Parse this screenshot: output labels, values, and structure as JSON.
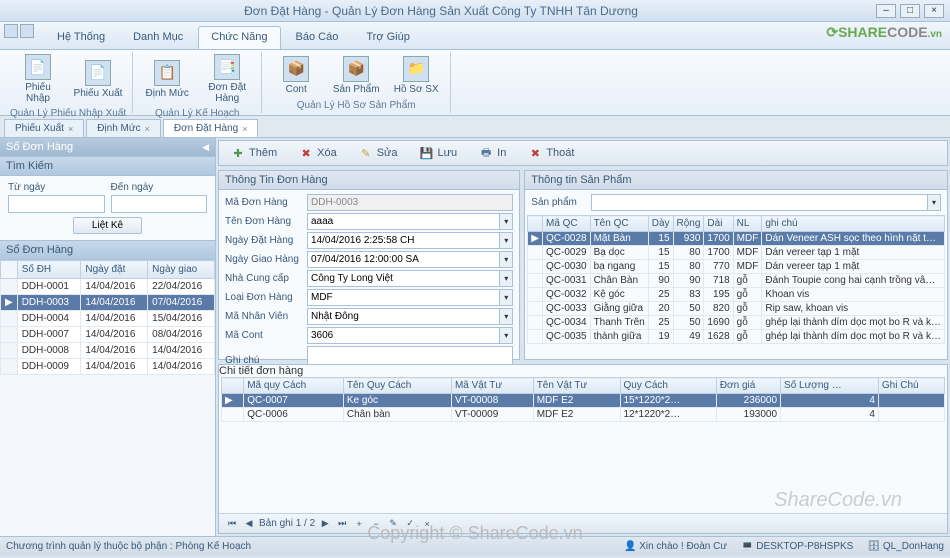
{
  "window": {
    "title": "Đơn Đặt Hàng - Quản Lý Đơn Hàng Sản Xuất Công Ty TNHH Tân Dương"
  },
  "logo": {
    "brand1": "SHARE",
    "brand2": "CODE",
    "suffix": ".vn"
  },
  "menu": {
    "tabs": [
      "Hệ Thống",
      "Danh Mục",
      "Chức Năng",
      "Báo Cáo",
      "Trợ Giúp"
    ],
    "active": 2
  },
  "ribbon": {
    "groups": [
      {
        "caption": "Quản Lý Phiếu Nhập Xuất",
        "buttons": [
          {
            "label": "Phiếu Nhập",
            "icon": "📄"
          },
          {
            "label": "Phiếu Xuất",
            "icon": "📄"
          }
        ]
      },
      {
        "caption": "Quản Lý Kế Hoạch",
        "buttons": [
          {
            "label": "Định Mức",
            "icon": "📋"
          },
          {
            "label": "Đơn Đặt Hàng",
            "icon": "📑"
          }
        ]
      },
      {
        "caption": "Quản Lý Hồ Sơ Sản Phẩm",
        "buttons": [
          {
            "label": "Cont",
            "icon": "📦"
          },
          {
            "label": "Sản Phẩm",
            "icon": "📦"
          },
          {
            "label": "Hồ Sơ SX",
            "icon": "📁"
          }
        ]
      }
    ]
  },
  "doctabs": [
    {
      "label": "Phiếu Xuất"
    },
    {
      "label": "Định Mức"
    },
    {
      "label": "Đơn Đặt Hàng",
      "active": true
    }
  ],
  "left": {
    "panel_title": "Sổ Đơn Hàng",
    "filter": {
      "title": "Tìm Kiếm",
      "from_label": "Từ ngày",
      "to_label": "Đến ngày",
      "list_btn": "Liệt Kê"
    },
    "orders": {
      "title": "Sổ Đơn Hàng",
      "cols": [
        "Số ĐH",
        "Ngày đặt",
        "Ngày giao"
      ],
      "rows": [
        {
          "id": "DDH-0001",
          "d1": "14/04/2016",
          "d2": "22/04/2016"
        },
        {
          "id": "DDH-0003",
          "d1": "14/04/2016",
          "d2": "07/04/2016",
          "sel": true
        },
        {
          "id": "DDH-0004",
          "d1": "14/04/2016",
          "d2": "15/04/2016"
        },
        {
          "id": "DDH-0007",
          "d1": "14/04/2016",
          "d2": "08/04/2016"
        },
        {
          "id": "DDH-0008",
          "d1": "14/04/2016",
          "d2": "14/04/2016"
        },
        {
          "id": "DDH-0009",
          "d1": "14/04/2016",
          "d2": "14/04/2016"
        }
      ]
    }
  },
  "toolbar": [
    {
      "label": "Thêm",
      "icon": "add",
      "glyph": "✚"
    },
    {
      "label": "Xóa",
      "icon": "del",
      "glyph": "✖"
    },
    {
      "label": "Sửa",
      "icon": "edit",
      "glyph": "✎"
    },
    {
      "label": "Lưu",
      "icon": "save",
      "glyph": "💾"
    },
    {
      "label": "In",
      "icon": "print",
      "glyph": "🖶"
    },
    {
      "label": "Thoát",
      "icon": "exit",
      "glyph": "✖"
    }
  ],
  "orderinfo": {
    "title": "Thông Tin Đơn Hàng",
    "fields": {
      "ma_label": "Mã Đơn Hàng",
      "ma_val": "DDH-0003",
      "ten_label": "Tên Đơn Hàng",
      "ten_val": "aaaa",
      "ngaydat_label": "Ngày Đặt Hàng",
      "ngaydat_val": "14/04/2016 2:25:58 CH",
      "ngaygiao_label": "Ngày Giao Hàng",
      "ngaygiao_val": "07/04/2016 12:00:00 SA",
      "ncc_label": "Nhà Cung cấp",
      "ncc_val": "Công Ty Long Việt",
      "loai_label": "Loại Đơn Hàng",
      "loai_val": "MDF",
      "nv_label": "Mã Nhân Viên",
      "nv_val": "Nhật Đông",
      "cont_label": "Mã Cont",
      "cont_val": "3606",
      "ghichu_label": "Ghi chú",
      "ghichu_val": ""
    }
  },
  "prodinfo": {
    "title": "Thông tin Sản Phẩm",
    "sp_label": "Sản phẩm",
    "cols": [
      "Mã QC",
      "Tên QC",
      "Dày",
      "Rộng",
      "Dài",
      "NL",
      "ghi chú"
    ],
    "rows": [
      {
        "ma": "QC-0028",
        "ten": "Mặt Bàn",
        "day": "15",
        "rong": "930",
        "dai": "1700",
        "nl": "MDF",
        "gc": "Dán Veneer ASH sọc theo hình nặt t…",
        "sel": true
      },
      {
        "ma": "QC-0029",
        "ten": "Bạ dọc",
        "day": "15",
        "rong": "80",
        "dai": "1700",
        "nl": "MDF",
        "gc": "Dán vereer tạp 1 mặt"
      },
      {
        "ma": "QC-0030",
        "ten": "bạ ngang",
        "day": "15",
        "rong": "80",
        "dai": "770",
        "nl": "MDF",
        "gc": "Dán vereer tạp 1 mặt"
      },
      {
        "ma": "QC-0031",
        "ten": "Chân Bàn",
        "day": "90",
        "rong": "90",
        "dai": "718",
        "nl": "gỗ",
        "gc": "Đánh Toupie cong hai cạnh trồng vâ…"
      },
      {
        "ma": "QC-0032",
        "ten": "Kệ góc",
        "day": "25",
        "rong": "83",
        "dai": "195",
        "nl": "gỗ",
        "gc": "Khoan vis"
      },
      {
        "ma": "QC-0033",
        "ten": "Giằng giữa",
        "day": "20",
        "rong": "50",
        "dai": "820",
        "nl": "gỗ",
        "gc": "Rip saw, khoan vis"
      },
      {
        "ma": "QC-0034",
        "ten": "Thanh Trên",
        "day": "25",
        "rong": "50",
        "dai": "1690",
        "nl": "gỗ",
        "gc": "ghép lại thành dím dọc mọt bo R và k…"
      },
      {
        "ma": "QC-0035",
        "ten": "thành giữa",
        "day": "19",
        "rong": "49",
        "dai": "1628",
        "nl": "gỗ",
        "gc": "ghép lại thành dím dọc mọt bo R và k…"
      }
    ]
  },
  "detail": {
    "title": "Chi tiết đơn hàng",
    "cols": [
      "Mã quy Cách",
      "Tên Quy Cách",
      "Mã Vật Tư",
      "Tên Vật Tư",
      "Quy Cách",
      "Đơn giá",
      "Số Lượng …",
      "Ghi Chú"
    ],
    "rows": [
      {
        "mqc": "QC-0007",
        "tqc": "Ke góc",
        "mvt": "VT-00008",
        "tvt": "MDF E2",
        "qc": "15*1220*2…",
        "dg": "236000",
        "sl": "4",
        "gc": "",
        "sel": true
      },
      {
        "mqc": "QC-0006",
        "tqc": "Chân bàn",
        "mvt": "VT-00009",
        "tvt": "MDF E2",
        "qc": "12*1220*2…",
        "dg": "193000",
        "sl": "4",
        "gc": ""
      }
    ],
    "pager": "Bản ghi 1 / 2"
  },
  "status": {
    "left": "Chương trình quản lý thuộc bộ phận : Phòng Kế Hoạch",
    "r1": "Xin chào ! Đoàn Cư",
    "r2": "DESKTOP-P8HSPKS",
    "r3": "QL_DonHang"
  },
  "watermark": "ShareCode.vn",
  "watermark2": "Copyright © ShareCode.vn"
}
